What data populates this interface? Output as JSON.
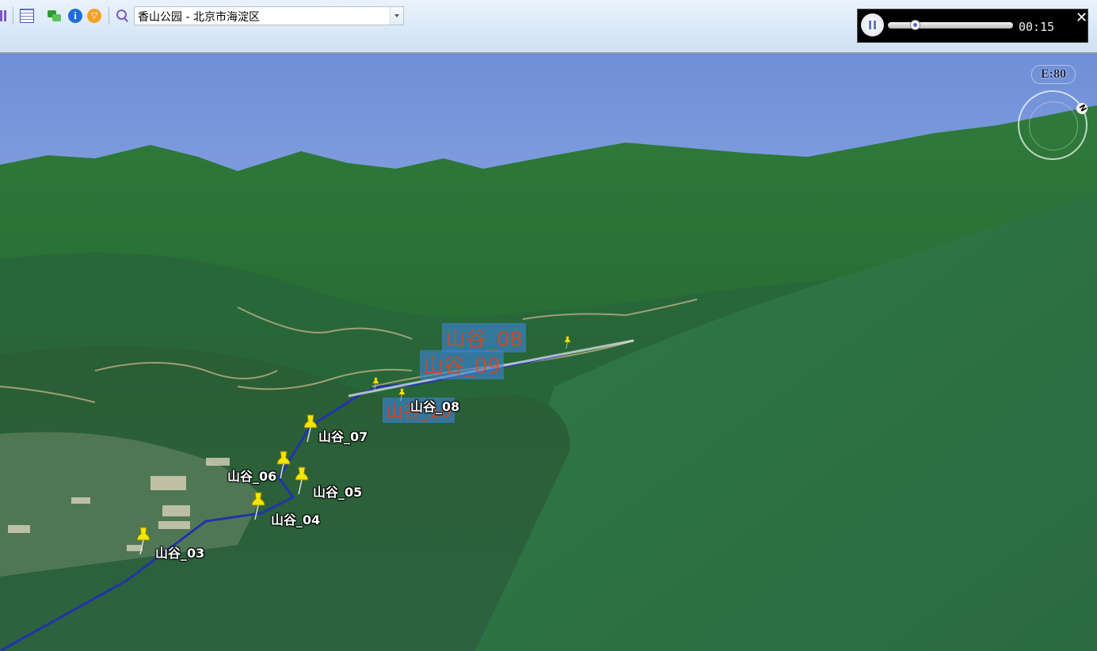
{
  "toolbar": {
    "search_value": "香山公园 - 北京市海淀区"
  },
  "player": {
    "time": "00:15",
    "progress_fraction": 0.19
  },
  "view": {
    "tilt_indicator": "E:80",
    "compass_letter": "N"
  },
  "placemarks": {
    "p03": "山谷_03",
    "p04": "山谷_04",
    "p05": "山谷_05",
    "p06": "山谷_06",
    "p07": "山谷_07",
    "p08": "山谷_08",
    "p08_far": "山谷_08",
    "p09_far": "山谷_09",
    "p10_far": "山谷_10"
  },
  "colors": {
    "sky_top": "#6f8fd8",
    "forest": "#2f6e3b",
    "track": "#2233aa",
    "pin": "#f2e600"
  }
}
